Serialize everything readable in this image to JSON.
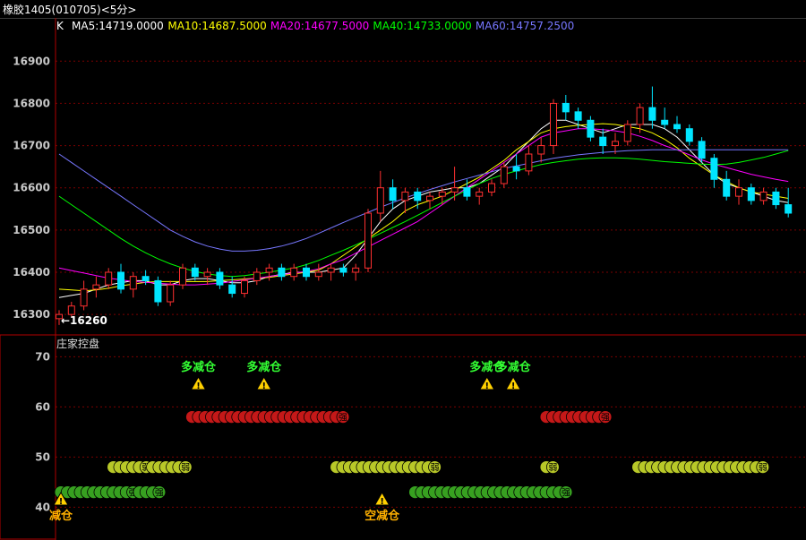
{
  "window": {
    "title_prefix": "橡胶1405",
    "code": "(010705)",
    "period": "<5分>"
  },
  "colors": {
    "background": "#000000",
    "grid": "#7a0000",
    "up": "#ff3030",
    "down": "#00e5ff",
    "ma5": "#ffffff",
    "ma10": "#ffff00",
    "ma20": "#ff00ff",
    "ma40": "#00ff00",
    "ma60": "#7777ff",
    "red_bead": "#c41818",
    "green_bead": "#37a020",
    "yellow_bead": "#b8c828",
    "signal_text": "#33ff33",
    "warn_text": "#ffb000"
  },
  "main_panel": {
    "indicator_label": "K",
    "ma_legend": [
      {
        "name": "MA5",
        "value": "14719.0000",
        "color_key": "ma5"
      },
      {
        "name": "MA10",
        "value": "14687.5000",
        "color_key": "ma10"
      },
      {
        "name": "MA20",
        "value": "14677.5000",
        "color_key": "ma20"
      },
      {
        "name": "MA40",
        "value": "14733.0000",
        "color_key": "ma40"
      },
      {
        "name": "MA60",
        "value": "14757.2500",
        "color_key": "ma60"
      }
    ],
    "low_marker": "←16260"
  },
  "sub_panel": {
    "title": "庄家控盘",
    "signals_top": [
      {
        "text": "多减仓",
        "bar": 10
      },
      {
        "text": "多减仓",
        "bar": 15
      },
      {
        "text": "多减仓",
        "bar": 32
      },
      {
        "text": "多减仓",
        "bar": 34
      }
    ],
    "signals_bottom": [
      {
        "text": "减仓",
        "bar": 0
      },
      {
        "text": "空减仓",
        "bar": 24
      }
    ],
    "bead_labels": {
      "red": "强",
      "green": "强",
      "yellow": "弱"
    }
  },
  "chart_data": [
    {
      "type": "candlestick",
      "title": "橡胶1405 (010705) <5分>",
      "ylim": [
        16260,
        16960
      ],
      "y_ticks": [
        16300,
        16400,
        16500,
        16600,
        16700,
        16800,
        16900
      ],
      "candles": [
        [
          16290,
          16310,
          16275,
          16300
        ],
        [
          16300,
          16330,
          16295,
          16320
        ],
        [
          16320,
          16380,
          16310,
          16360
        ],
        [
          16360,
          16390,
          16340,
          16370
        ],
        [
          16370,
          16410,
          16360,
          16400
        ],
        [
          16400,
          16420,
          16350,
          16360
        ],
        [
          16360,
          16400,
          16340,
          16390
        ],
        [
          16390,
          16405,
          16370,
          16380
        ],
        [
          16380,
          16390,
          16320,
          16330
        ],
        [
          16330,
          16380,
          16320,
          16370
        ],
        [
          16370,
          16420,
          16360,
          16410
        ],
        [
          16410,
          16420,
          16380,
          16390
        ],
        [
          16390,
          16410,
          16370,
          16400
        ],
        [
          16400,
          16410,
          16360,
          16370
        ],
        [
          16370,
          16390,
          16340,
          16350
        ],
        [
          16350,
          16390,
          16340,
          16380
        ],
        [
          16380,
          16410,
          16370,
          16400
        ],
        [
          16400,
          16420,
          16380,
          16410
        ],
        [
          16410,
          16420,
          16380,
          16390
        ],
        [
          16390,
          16420,
          16380,
          16410
        ],
        [
          16410,
          16420,
          16380,
          16390
        ],
        [
          16390,
          16420,
          16380,
          16400
        ],
        [
          16400,
          16420,
          16380,
          16410
        ],
        [
          16410,
          16420,
          16390,
          16400
        ],
        [
          16400,
          16420,
          16380,
          16410
        ],
        [
          16410,
          16550,
          16400,
          16540
        ],
        [
          16540,
          16640,
          16520,
          16600
        ],
        [
          16600,
          16620,
          16550,
          16570
        ],
        [
          16570,
          16600,
          16540,
          16590
        ],
        [
          16590,
          16600,
          16550,
          16570
        ],
        [
          16570,
          16590,
          16550,
          16580
        ],
        [
          16580,
          16600,
          16560,
          16590
        ],
        [
          16590,
          16650,
          16570,
          16600
        ],
        [
          16600,
          16620,
          16570,
          16580
        ],
        [
          16580,
          16600,
          16560,
          16590
        ],
        [
          16590,
          16620,
          16580,
          16610
        ],
        [
          16610,
          16660,
          16600,
          16650
        ],
        [
          16650,
          16680,
          16620,
          16640
        ],
        [
          16640,
          16700,
          16630,
          16680
        ],
        [
          16680,
          16720,
          16660,
          16700
        ],
        [
          16700,
          16810,
          16680,
          16800
        ],
        [
          16800,
          16820,
          16760,
          16780
        ],
        [
          16780,
          16790,
          16740,
          16760
        ],
        [
          16760,
          16770,
          16710,
          16720
        ],
        [
          16720,
          16740,
          16680,
          16700
        ],
        [
          16700,
          16730,
          16680,
          16710
        ],
        [
          16710,
          16760,
          16700,
          16750
        ],
        [
          16750,
          16800,
          16730,
          16790
        ],
        [
          16790,
          16840,
          16740,
          16760
        ],
        [
          16760,
          16790,
          16740,
          16750
        ],
        [
          16750,
          16770,
          16730,
          16740
        ],
        [
          16740,
          16750,
          16700,
          16710
        ],
        [
          16710,
          16720,
          16660,
          16670
        ],
        [
          16670,
          16680,
          16600,
          16620
        ],
        [
          16620,
          16640,
          16570,
          16580
        ],
        [
          16580,
          16620,
          16560,
          16600
        ],
        [
          16600,
          16610,
          16560,
          16570
        ],
        [
          16570,
          16600,
          16560,
          16590
        ],
        [
          16590,
          16600,
          16550,
          16560
        ],
        [
          16560,
          16600,
          16530,
          16540
        ]
      ],
      "ma_lines": [
        {
          "name": "MA5",
          "values": [
            16340,
            16345,
            16350,
            16360,
            16370,
            16375,
            16380,
            16380,
            16370,
            16370,
            16380,
            16385,
            16385,
            16380,
            16375,
            16375,
            16380,
            16390,
            16395,
            16400,
            16400,
            16400,
            16405,
            16410,
            16440,
            16480,
            16520,
            16550,
            16570,
            16580,
            16590,
            16595,
            16600,
            16600,
            16610,
            16630,
            16650,
            16680,
            16710,
            16740,
            16760,
            16760,
            16750,
            16740,
            16730,
            16740,
            16750,
            16750,
            16750,
            16740,
            16720,
            16690,
            16660,
            16630,
            16610,
            16600,
            16590,
            16580,
            16570,
            16565
          ]
        },
        {
          "name": "MA10",
          "values": [
            16360,
            16358,
            16356,
            16358,
            16362,
            16368,
            16372,
            16376,
            16378,
            16378,
            16378,
            16378,
            16378,
            16380,
            16382,
            16384,
            16386,
            16388,
            16392,
            16396,
            16400,
            16405,
            16420,
            16440,
            16460,
            16480,
            16500,
            16520,
            16545,
            16560,
            16570,
            16580,
            16595,
            16610,
            16625,
            16645,
            16665,
            16690,
            16710,
            16730,
            16740,
            16745,
            16748,
            16750,
            16752,
            16750,
            16745,
            16740,
            16730,
            16715,
            16695,
            16670,
            16650,
            16630,
            16615,
            16600,
            16590,
            16585,
            16580,
            16575
          ]
        },
        {
          "name": "MA20",
          "values": [
            16410,
            16404,
            16398,
            16392,
            16386,
            16382,
            16378,
            16376,
            16374,
            16372,
            16370,
            16370,
            16372,
            16374,
            16378,
            16382,
            16386,
            16390,
            16394,
            16398,
            16402,
            16408,
            16420,
            16430,
            16445,
            16460,
            16475,
            16490,
            16505,
            16520,
            16540,
            16560,
            16580,
            16600,
            16620,
            16640,
            16660,
            16680,
            16700,
            16720,
            16730,
            16735,
            16740,
            16740,
            16738,
            16735,
            16730,
            16722,
            16712,
            16700,
            16690,
            16678,
            16666,
            16656,
            16648,
            16640,
            16632,
            16626,
            16620,
            16615
          ]
        },
        {
          "name": "MA40",
          "values": [
            16580,
            16560,
            16540,
            16520,
            16500,
            16480,
            16462,
            16446,
            16432,
            16420,
            16410,
            16402,
            16396,
            16392,
            16390,
            16392,
            16396,
            16400,
            16405,
            16410,
            16418,
            16428,
            16440,
            16452,
            16465,
            16478,
            16492,
            16506,
            16520,
            16535,
            16550,
            16565,
            16580,
            16595,
            16610,
            16622,
            16632,
            16640,
            16648,
            16655,
            16660,
            16664,
            16668,
            16670,
            16671,
            16671,
            16670,
            16668,
            16665,
            16662,
            16660,
            16658,
            16656,
            16655,
            16656,
            16660,
            16666,
            16672,
            16680,
            16688
          ]
        },
        {
          "name": "MA60",
          "values": [
            16680,
            16660,
            16640,
            16620,
            16600,
            16580,
            16560,
            16540,
            16520,
            16500,
            16485,
            16472,
            16462,
            16455,
            16450,
            16450,
            16452,
            16456,
            16462,
            16470,
            16480,
            16492,
            16505,
            16518,
            16530,
            16542,
            16554,
            16565,
            16576,
            16586,
            16596,
            16605,
            16614,
            16622,
            16630,
            16638,
            16646,
            16652,
            16658,
            16664,
            16670,
            16674,
            16678,
            16681,
            16684,
            16686,
            16688,
            16689,
            16690,
            16690,
            16690,
            16690,
            16690,
            16690,
            16690,
            16690,
            16690,
            16690,
            16690,
            16690
          ]
        }
      ]
    },
    {
      "type": "bead-indicator",
      "title": "庄家控盘",
      "ylim": [
        34,
        74
      ],
      "y_ticks": [
        40,
        50,
        60,
        70
      ],
      "bars": 57,
      "rows": [
        {
          "level": 58,
          "color_key": "red_bead",
          "ranges": [
            [
              10,
              21
            ],
            [
              37,
              41
            ]
          ]
        },
        {
          "level": 48,
          "color_key": "yellow_bead",
          "ranges": [
            [
              4,
              6
            ],
            [
              7,
              9
            ],
            [
              21,
              28
            ],
            [
              37,
              37
            ],
            [
              44,
              53
            ]
          ]
        },
        {
          "level": 43,
          "color_key": "green_bead",
          "ranges": [
            [
              0,
              5
            ],
            [
              6,
              7
            ],
            [
              27,
              38
            ]
          ]
        }
      ]
    }
  ]
}
